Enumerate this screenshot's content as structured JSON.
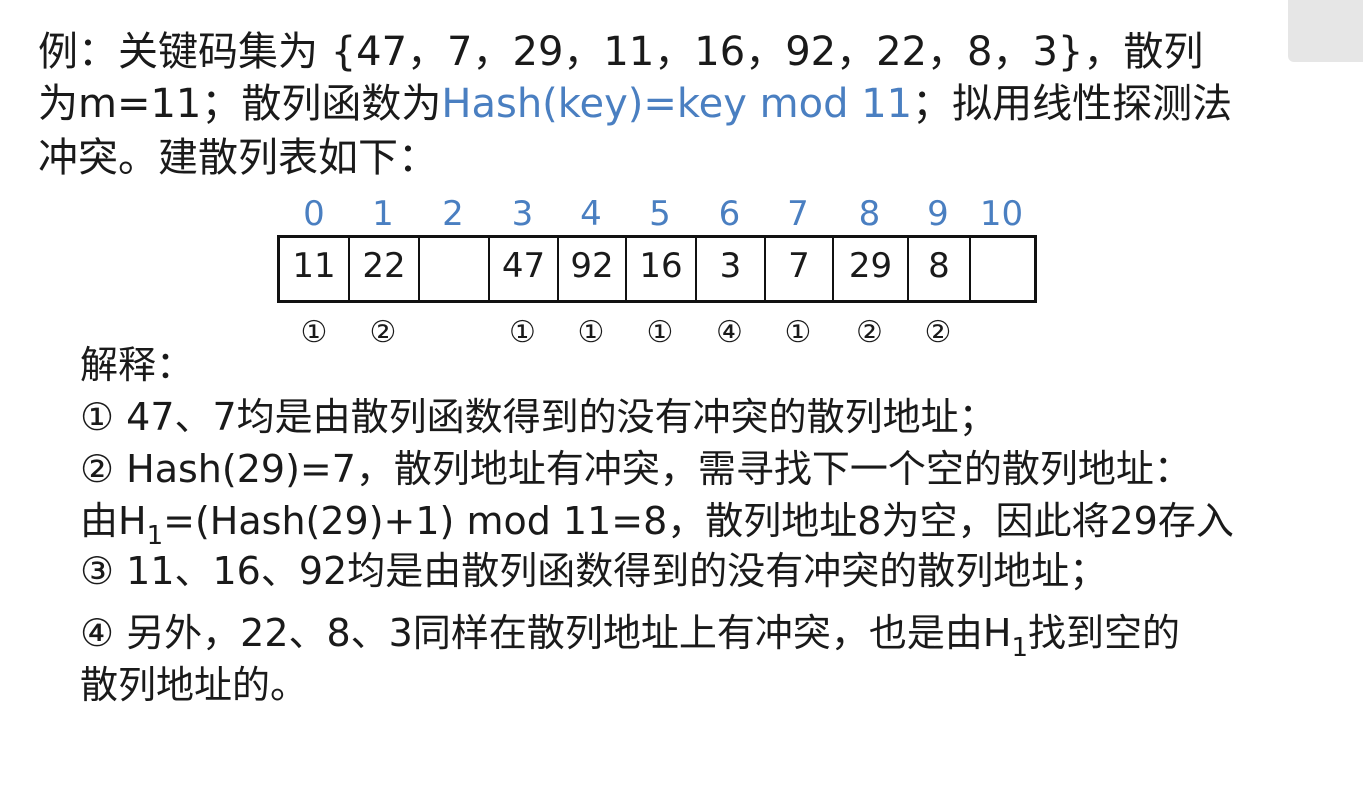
{
  "example": {
    "line1": "例：关键码集为 {47，7，29，11，16，92，22，8，3}，散列",
    "line2_a": "为m=11；散列函数为",
    "line2_func": "Hash(key)=key  mod  11",
    "line2_b": "；拟用线性探测法",
    "line3": "冲突。建散列表如下："
  },
  "table": {
    "indices": [
      "0",
      "1",
      "2",
      "3",
      "4",
      "5",
      "6",
      "7",
      "8",
      "9",
      "10"
    ],
    "values": [
      "11",
      "22",
      "",
      "47",
      "92",
      "16",
      "3",
      "7",
      "29",
      "8",
      ""
    ],
    "probes": [
      "①",
      "②",
      "",
      "①",
      "①",
      "①",
      "④",
      "①",
      "②",
      "②",
      ""
    ]
  },
  "explanation": {
    "title": "解释：",
    "item1": "①  47、7均是由散列函数得到的没有冲突的散列地址；",
    "item2": "②  Hash(29)=7，散列地址有冲突，需寻找下一个空的散列地址：",
    "item2b_pre": "由H",
    "item2b_sub": "1",
    "item2b_post": "=(Hash(29)+1) mod 11=8，散列地址8为空，因此将29存入",
    "item3": "③  11、16、92均是由散列函数得到的没有冲突的散列地址；",
    "item4_pre": "④  另外，22、8、3同样在散列地址上有冲突，也是由H",
    "item4_sub": "1",
    "item4_post": "找到空的",
    "item4b": "散列地址的。"
  }
}
